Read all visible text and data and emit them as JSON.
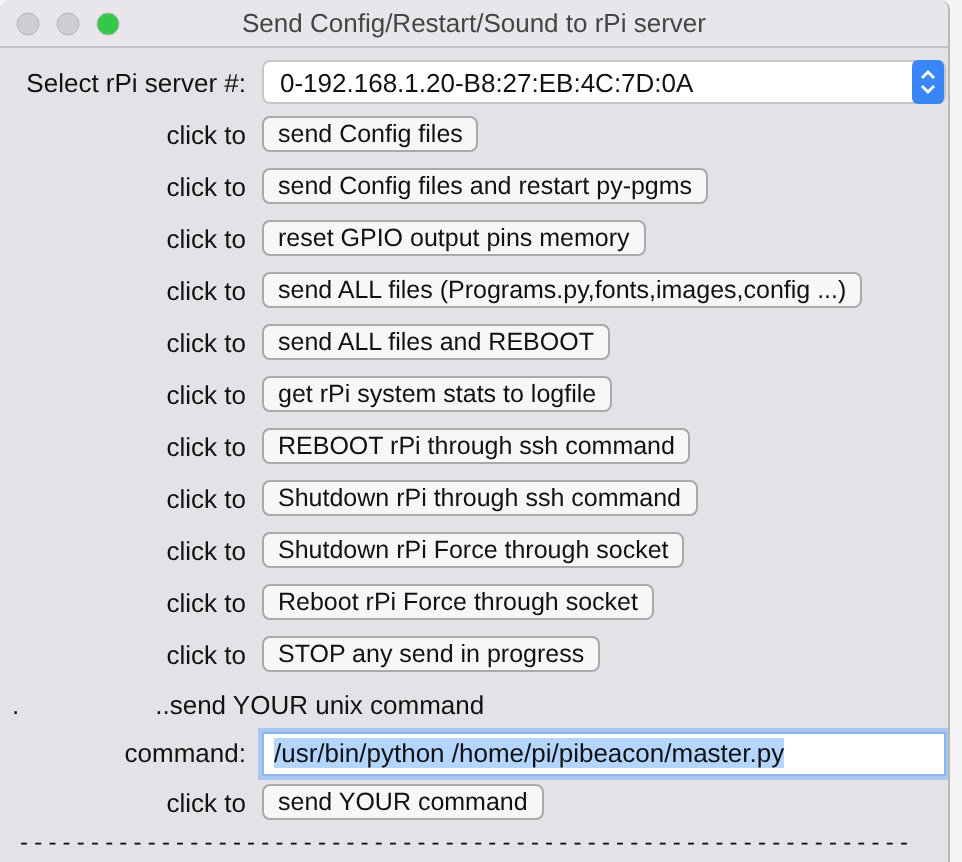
{
  "window": {
    "title": "Send Config/Restart/Sound to rPi server"
  },
  "server_select": {
    "label": "Select rPi server #:",
    "value": "0-192.168.1.20-B8:27:EB:4C:7D:0A"
  },
  "actions": [
    {
      "label": "click to",
      "button": "send Config files"
    },
    {
      "label": "click to",
      "button": "send Config files and restart py-pgms"
    },
    {
      "label": "click to",
      "button": "reset GPIO output pins memory"
    },
    {
      "label": "click to",
      "button": "send ALL files (Programs.py,fonts,images,config ...)"
    },
    {
      "label": "click to",
      "button": "send ALL files and REBOOT"
    },
    {
      "label": "click to",
      "button": "get rPi system stats to logfile"
    },
    {
      "label": "click to",
      "button": "REBOOT rPi through ssh command"
    },
    {
      "label": "click to",
      "button": "Shutdown rPi through ssh command"
    },
    {
      "label": "click to",
      "button": "Shutdown rPi Force through socket"
    },
    {
      "label": "click to",
      "button": "Reboot rPi Force through socket"
    },
    {
      "label": "click to",
      "button": "STOP any send in progress"
    }
  ],
  "unix_section": {
    "dot": ".",
    "heading": "..send YOUR unix command"
  },
  "command_field": {
    "label": "command:",
    "value": "/usr/bin/python /home/pi/pibeacon/master.py",
    "focused": true
  },
  "send_command": {
    "label": "click to",
    "button": "send YOUR command"
  },
  "separator": "---------------------------------------------------------------"
}
